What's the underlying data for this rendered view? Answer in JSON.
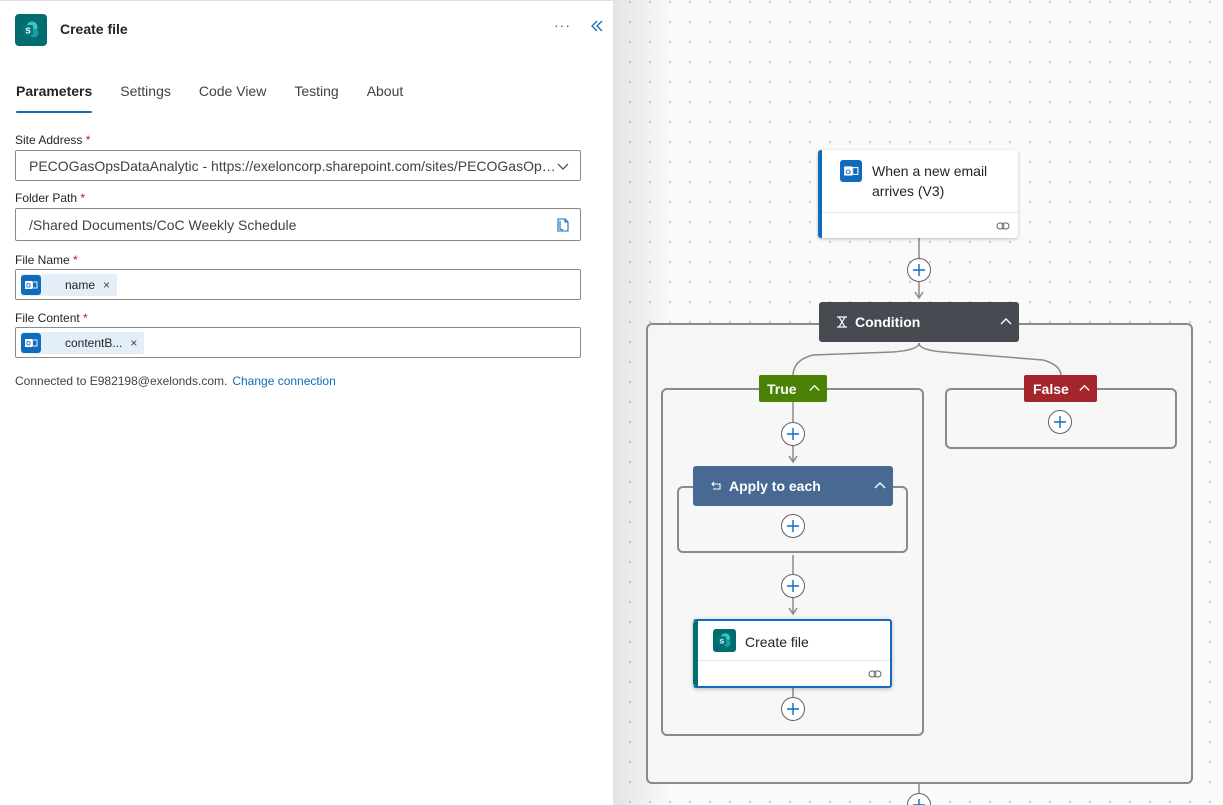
{
  "panel": {
    "title": "Create file",
    "more": "···",
    "tabs": [
      "Parameters",
      "Settings",
      "Code View",
      "Testing",
      "About"
    ],
    "fields": {
      "site_address": {
        "label": "Site Address",
        "required": "*",
        "value": "PECOGasOpsDataAnalytic - https://exeloncorp.sharepoint.com/sites/PECOGasOps..."
      },
      "folder_path": {
        "label": "Folder Path",
        "required": "*",
        "value": "/Shared Documents/CoC Weekly Schedule"
      },
      "file_name": {
        "label": "File Name",
        "required": "*",
        "token": "name",
        "token_close": "×"
      },
      "file_content": {
        "label": "File Content",
        "required": "*",
        "token": "contentB...",
        "token_close": "×"
      }
    },
    "connection": {
      "text": "Connected to E982198@exelonds.com.",
      "link": "Change connection"
    }
  },
  "canvas": {
    "trigger": {
      "title_line1": "When a new email",
      "title_line2": "arrives (V3)"
    },
    "condition": {
      "label": "Condition",
      "color": "#474a51"
    },
    "true_branch": {
      "label": "True",
      "color": "#498205"
    },
    "false_branch": {
      "label": "False",
      "color": "#a4262c"
    },
    "apply_to_each": {
      "label": "Apply to each",
      "color": "#486991"
    },
    "create_file": {
      "label": "Create file"
    }
  },
  "colors": {
    "accent": "#0f6cbd",
    "sharepoint": "#036c70",
    "outlook": "#0f6cbd"
  }
}
